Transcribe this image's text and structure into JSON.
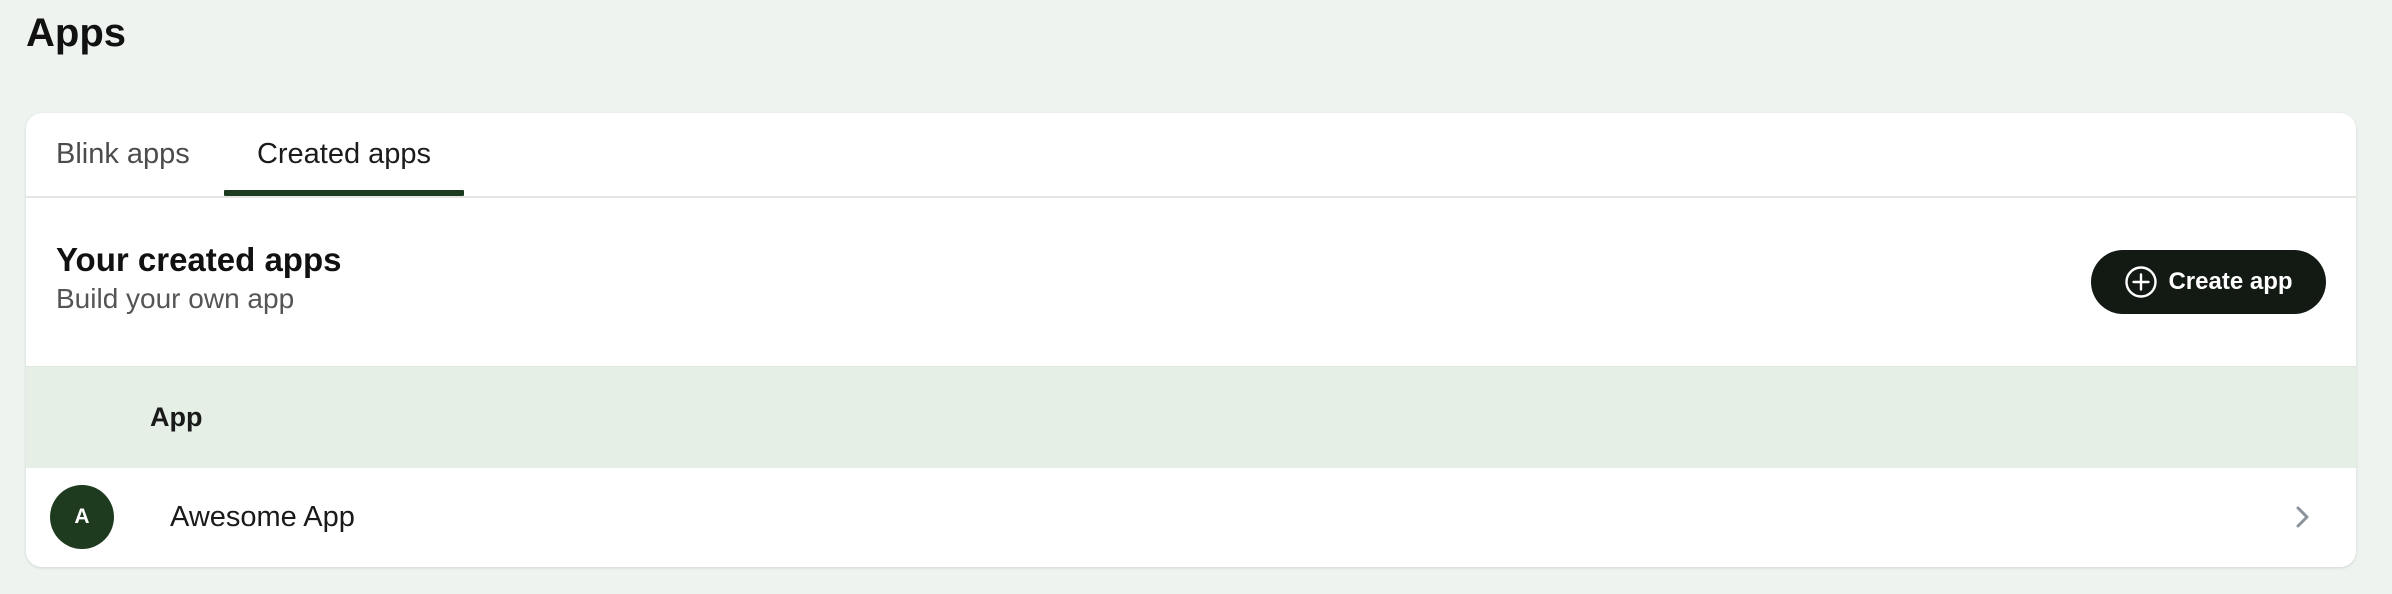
{
  "page": {
    "title": "Apps"
  },
  "tabs": [
    {
      "label": "Blink apps",
      "active": false
    },
    {
      "label": "Created apps",
      "active": true
    }
  ],
  "section": {
    "title": "Your created apps",
    "subtitle": "Build your own app",
    "create_button_label": "Create app"
  },
  "table": {
    "columns": [
      "App"
    ],
    "rows": [
      {
        "avatar_letter": "A",
        "name": "Awesome App"
      }
    ]
  },
  "icons": {
    "create": "plus-circle-icon",
    "row_action": "chevron-right-icon"
  },
  "colors": {
    "background": "#eef3ef",
    "accent": "#1d3b1f",
    "button": "#121a13",
    "table_header": "#e5efe6"
  }
}
